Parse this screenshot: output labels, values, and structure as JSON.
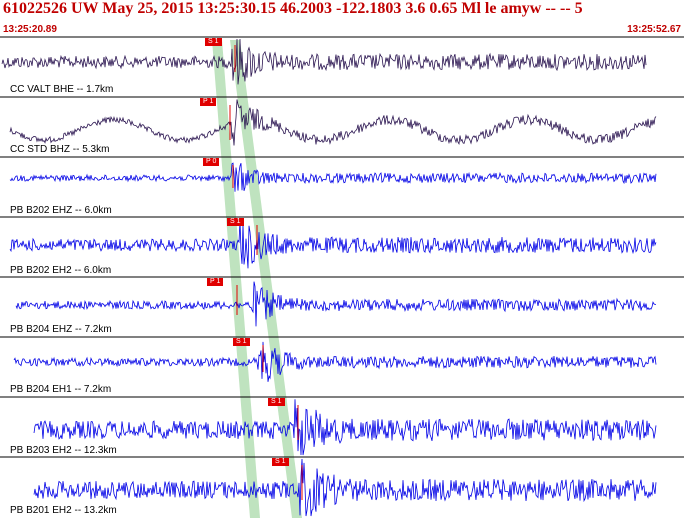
{
  "header": {
    "title": "61022526 UW May 25, 2015 13:25:30.15   46.2003 -122.1803  3.6 0.65 Ml le amyw -- --   5",
    "start_time": "13:25:20.89",
    "end_time": "13:25:52.67"
  },
  "colors": {
    "header_text": "#c00000",
    "trace_dark": "#2a1450",
    "trace_blue": "#0000e6",
    "pick_marker": "#e00000",
    "window_band": "#bfe3bf",
    "divider": "#000000"
  },
  "traces": [
    {
      "label": "CC VALT BHE -- 1.7km",
      "pick": "S 1",
      "color": "dark"
    },
    {
      "label": "CC STD BHZ -- 5.3km",
      "pick": "P 1",
      "color": "dark"
    },
    {
      "label": "PB B202 EHZ -- 6.0km",
      "pick": "P 0",
      "color": "blue"
    },
    {
      "label": "PB B202 EH2 -- 6.0km",
      "pick": "S 1",
      "color": "blue"
    },
    {
      "label": "PB B204 EHZ -- 7.2km",
      "pick": "P 1",
      "color": "blue"
    },
    {
      "label": "PB B204 EH1 -- 7.2km",
      "pick": "S 1",
      "color": "blue"
    },
    {
      "label": "PB B203 EH2 -- 12.3km",
      "pick": "S 1",
      "color": "blue"
    },
    {
      "label": "PB B201 EH2 -- 13.2km",
      "pick": "S 1",
      "color": "blue"
    }
  ]
}
